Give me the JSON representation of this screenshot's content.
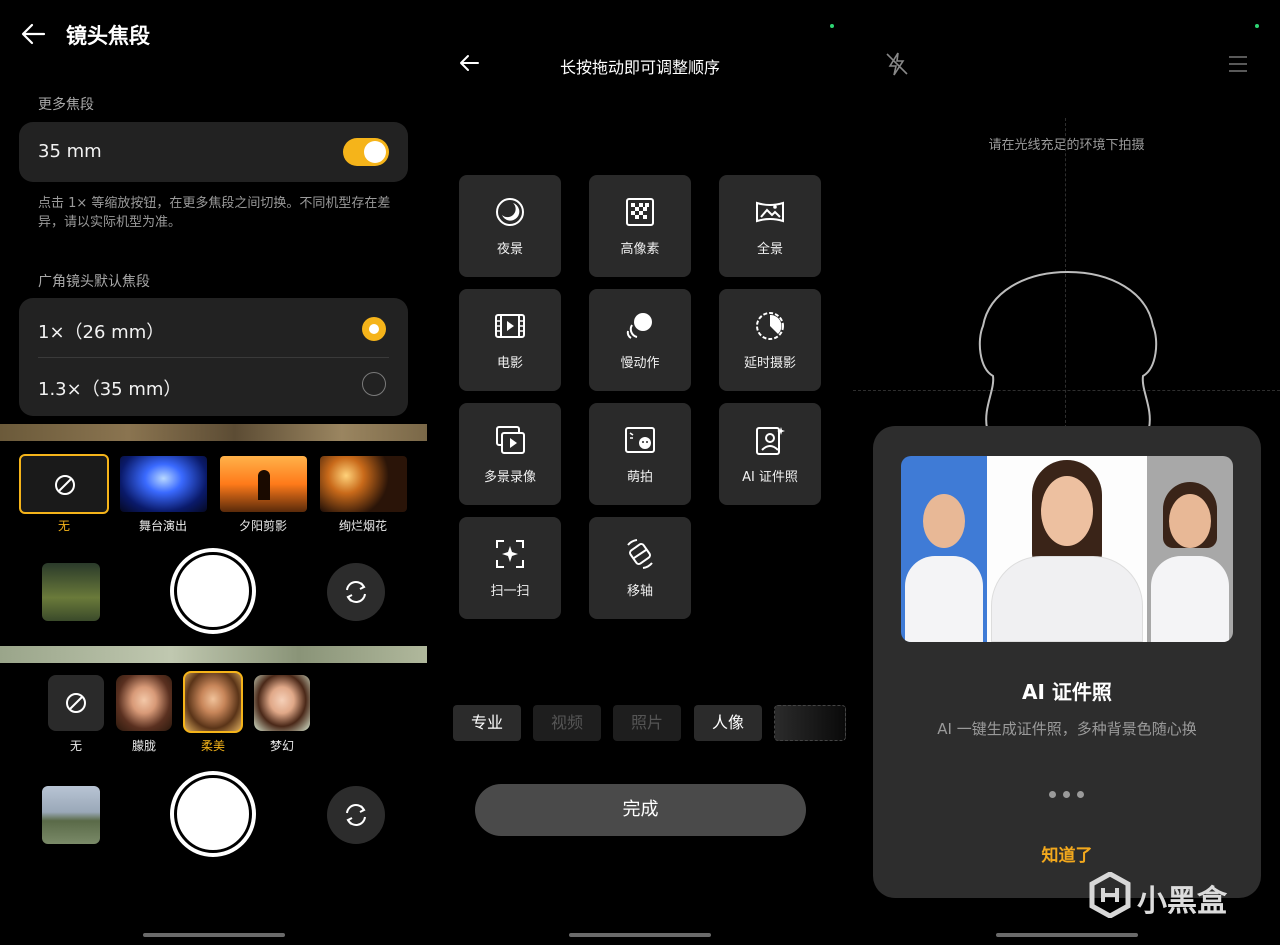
{
  "panel1": {
    "header": {
      "title": "镜头焦段"
    },
    "more_focal": {
      "section_label": "更多焦段",
      "row_label": "35 mm",
      "toggle_on": true,
      "hint": "点击 1× 等缩放按钮，在更多焦段之间切换。不同机型存在差异，请以实际机型为准。"
    },
    "wide_default": {
      "section_label": "广角镜头默认焦段",
      "options": [
        {
          "label": "1×（26 mm）",
          "selected": true
        },
        {
          "label": "1.3×（35 mm）",
          "selected": false
        }
      ]
    },
    "filters_top": [
      {
        "label": "无",
        "selected": true
      },
      {
        "label": "舞台演出",
        "selected": false
      },
      {
        "label": "夕阳剪影",
        "selected": false
      },
      {
        "label": "绚烂烟花",
        "selected": false
      }
    ],
    "filters_bottom": [
      {
        "label": "无",
        "selected": false
      },
      {
        "label": "朦胧",
        "selected": false
      },
      {
        "label": "柔美",
        "selected": true
      },
      {
        "label": "梦幻",
        "selected": false
      }
    ]
  },
  "panel2": {
    "header": {
      "title": "长按拖动即可调整顺序"
    },
    "tiles": [
      {
        "label": "夜景",
        "icon": "night-icon"
      },
      {
        "label": "高像素",
        "icon": "high-pixel-icon"
      },
      {
        "label": "全景",
        "icon": "panorama-icon"
      },
      {
        "label": "电影",
        "icon": "film-icon"
      },
      {
        "label": "慢动作",
        "icon": "slow-motion-icon"
      },
      {
        "label": "延时摄影",
        "icon": "timelapse-icon"
      },
      {
        "label": "多景录像",
        "icon": "multi-view-icon"
      },
      {
        "label": "萌拍",
        "icon": "cute-shot-icon"
      },
      {
        "label": "AI 证件照",
        "icon": "id-photo-icon"
      },
      {
        "label": "扫一扫",
        "icon": "scan-icon"
      },
      {
        "label": "移轴",
        "icon": "tilt-shift-icon"
      }
    ],
    "mode_bar": [
      {
        "label": "专业",
        "dim": false
      },
      {
        "label": "视频",
        "dim": true
      },
      {
        "label": "照片",
        "dim": true
      },
      {
        "label": "人像",
        "dim": false
      }
    ],
    "done_label": "完成"
  },
  "panel3": {
    "hint": "请在光线充足的环境下拍摄",
    "sheet": {
      "title": "AI 证件照",
      "desc": "AI 一键生成证件照，多种背景色随心换",
      "button": "知道了",
      "page_dots": 3
    },
    "watermark": "小黑盒"
  },
  "colors": {
    "accent": "#f5b41a",
    "tile_bg": "#2a2a2a",
    "card_bg": "#222222"
  }
}
